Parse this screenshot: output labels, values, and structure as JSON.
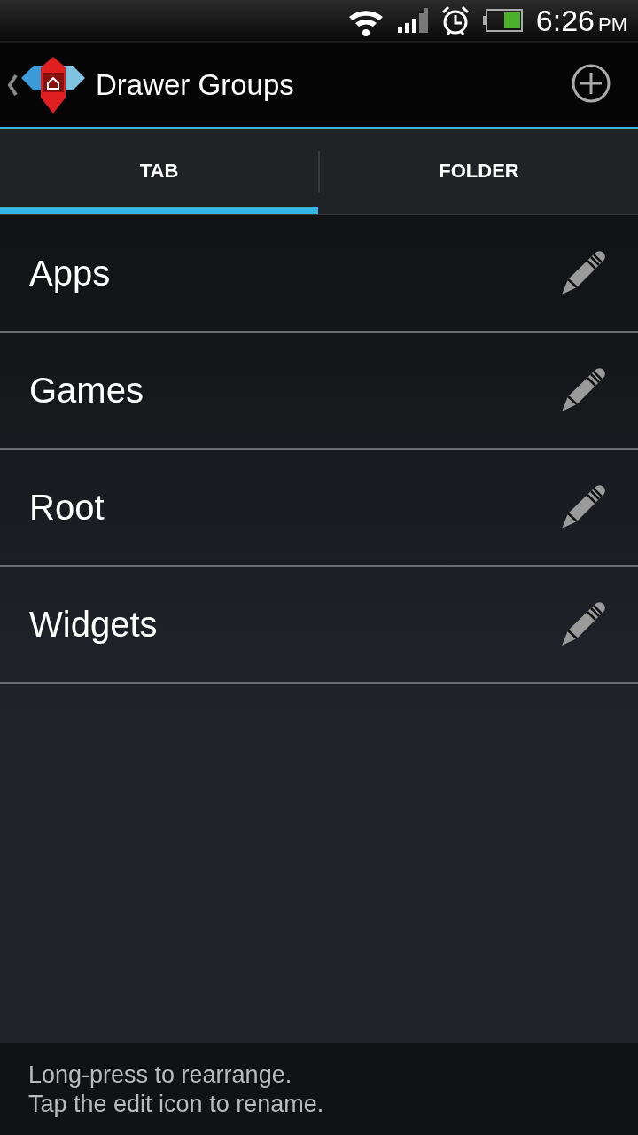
{
  "status_bar": {
    "time": "6:26",
    "period": "PM"
  },
  "action_bar": {
    "title": "Drawer Groups"
  },
  "tabs": [
    {
      "label": "TAB",
      "selected": true
    },
    {
      "label": "FOLDER",
      "selected": false
    }
  ],
  "groups": [
    {
      "name": "Apps"
    },
    {
      "name": "Games"
    },
    {
      "name": "Root"
    },
    {
      "name": "Widgets"
    }
  ],
  "hint": {
    "lines": [
      "Long-press to rearrange.",
      "Tap the edit icon to rename."
    ]
  }
}
